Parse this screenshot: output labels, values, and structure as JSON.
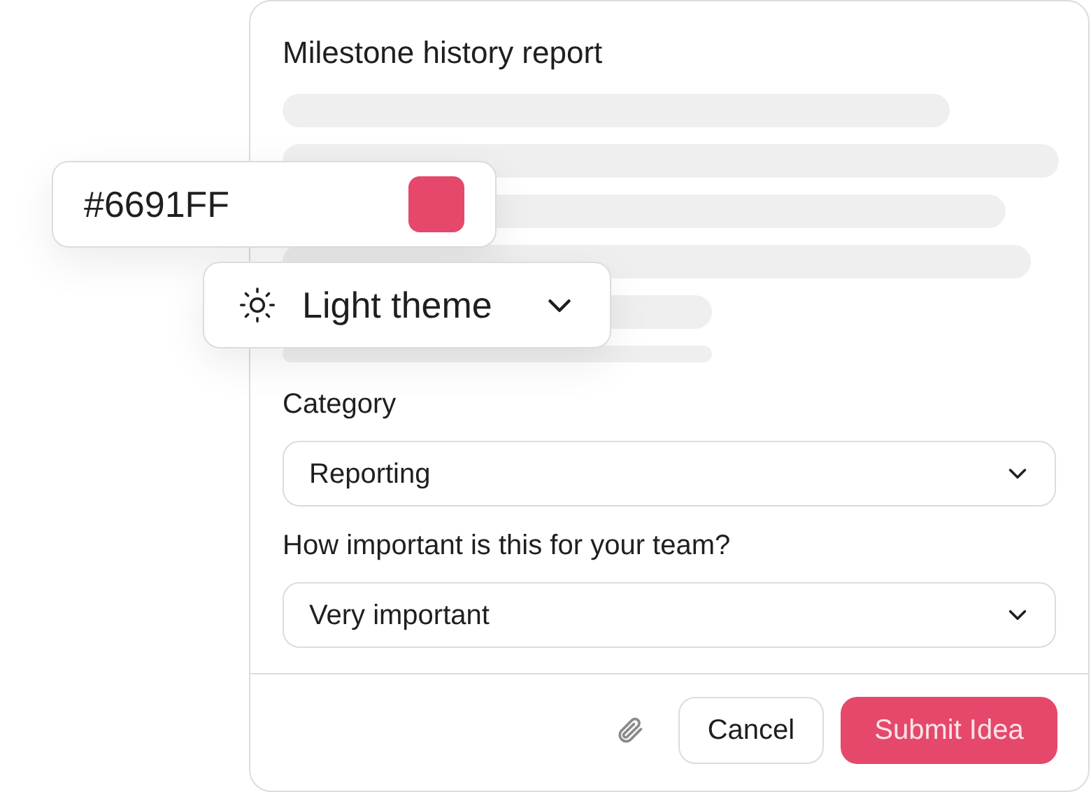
{
  "form": {
    "title": "Milestone history report",
    "fields": [
      {
        "label": "Category",
        "value": "Reporting"
      },
      {
        "label": "How important is this for your team?",
        "value": "Very important"
      }
    ],
    "buttons": {
      "cancel": "Cancel",
      "submit": "Submit Idea"
    }
  },
  "color_field": {
    "value": "#6691FF",
    "swatch": {
      "color": "#e5486a"
    }
  },
  "theme_menu": {
    "label": "Light theme"
  }
}
